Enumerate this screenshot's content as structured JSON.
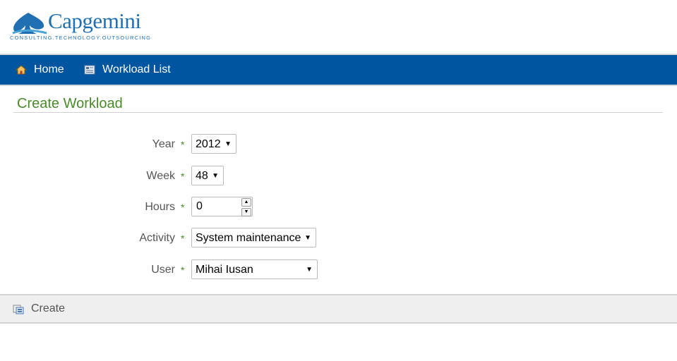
{
  "brand": {
    "name": "Capgemini",
    "tagline": "CONSULTING.TECHNOLOGY.OUTSOURCING"
  },
  "nav": {
    "home": "Home",
    "workload_list": "Workload List"
  },
  "page": {
    "title": "Create Workload"
  },
  "form": {
    "required_marker": "*",
    "year": {
      "label": "Year",
      "value": "2012"
    },
    "week": {
      "label": "Week",
      "value": "48"
    },
    "hours": {
      "label": "Hours",
      "value": "0"
    },
    "activity": {
      "label": "Activity",
      "value": "System maintenance"
    },
    "user": {
      "label": "User",
      "value": "Mihai Iusan"
    }
  },
  "actions": {
    "create": "Create"
  },
  "colors": {
    "navbar": "#0055a0",
    "title": "#4a8a2a",
    "brand": "#1f6fb2"
  }
}
